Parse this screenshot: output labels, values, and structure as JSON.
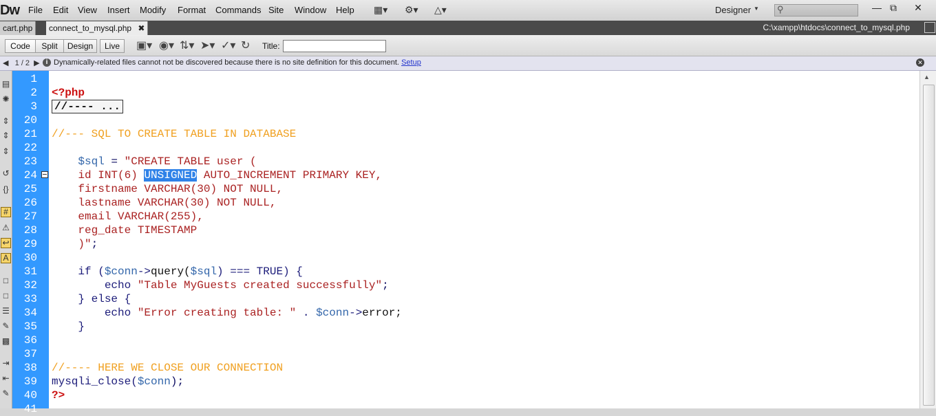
{
  "app": {
    "logo": "Dw"
  },
  "menu": [
    "File",
    "Edit",
    "View",
    "Insert",
    "Modify",
    "Format",
    "Commands",
    "Site",
    "Window",
    "Help"
  ],
  "toolbar_icons": [
    "layout-icon",
    "gear-icon",
    "site-icon"
  ],
  "workspace": {
    "label": "Designer"
  },
  "window_controls": [
    "minimize",
    "maximize",
    "close"
  ],
  "tabs": [
    {
      "label": "cart.php",
      "active": false
    },
    {
      "label": "connect_to_mysql.php",
      "active": true
    }
  ],
  "file_path": "C:\\xampp\\htdocs\\connect_to_mysql.php",
  "doc_toolbar": {
    "views": [
      "Code",
      "Split",
      "Design",
      "Live"
    ],
    "active_view": "Code",
    "title_label": "Title:",
    "title_value": ""
  },
  "info_bar": {
    "nav": "1 / 2",
    "message": "Dynamically-related files cannot not be discovered because there is no site definition for this document.",
    "link": "Setup"
  },
  "code": {
    "line_numbers": [
      "1",
      "2",
      "3",
      "20",
      "21",
      "22",
      "23",
      "24",
      "25",
      "26",
      "27",
      "28",
      "29",
      "30",
      "31",
      "32",
      "33",
      "34",
      "35",
      "36",
      "37",
      "38",
      "39",
      "40",
      "41"
    ],
    "lines": [
      {
        "n": "1",
        "tokens": []
      },
      {
        "n": "2",
        "tokens": [
          {
            "t": "<?php",
            "c": "kw"
          }
        ]
      },
      {
        "n": "3",
        "tokens": [
          {
            "t": "//---- ...",
            "c": "fold"
          }
        ]
      },
      {
        "n": "20",
        "tokens": []
      },
      {
        "n": "21",
        "tokens": [
          {
            "t": "//--- SQL TO CREATE TABLE IN DATABASE",
            "c": "cm"
          }
        ]
      },
      {
        "n": "22",
        "tokens": []
      },
      {
        "n": "23",
        "tokens": [
          {
            "t": "    ",
            "c": "bk"
          },
          {
            "t": "$sql",
            "c": "vb"
          },
          {
            "t": " = ",
            "c": "dk"
          },
          {
            "t": "\"CREATE TABLE user (",
            "c": "r"
          }
        ]
      },
      {
        "n": "24",
        "tokens": [
          {
            "t": "    id INT(6) ",
            "c": "r"
          },
          {
            "t": "UNSIGNED",
            "c": "sel"
          },
          {
            "t": " AUTO_INCREMENT PRIMARY KEY,",
            "c": "r"
          }
        ]
      },
      {
        "n": "25",
        "tokens": [
          {
            "t": "    firstname VARCHAR(30) NOT NULL,",
            "c": "r"
          }
        ]
      },
      {
        "n": "26",
        "tokens": [
          {
            "t": "    lastname VARCHAR(30) NOT NULL,",
            "c": "r"
          }
        ]
      },
      {
        "n": "27",
        "tokens": [
          {
            "t": "    email VARCHAR(255),",
            "c": "r"
          }
        ]
      },
      {
        "n": "28",
        "tokens": [
          {
            "t": "    reg_date TIMESTAMP",
            "c": "r"
          }
        ]
      },
      {
        "n": "29",
        "tokens": [
          {
            "t": "    )\"",
            "c": "r"
          },
          {
            "t": ";",
            "c": "dk"
          }
        ]
      },
      {
        "n": "30",
        "tokens": []
      },
      {
        "n": "31",
        "tokens": [
          {
            "t": "    if (",
            "c": "fn"
          },
          {
            "t": "$conn",
            "c": "vb"
          },
          {
            "t": "->",
            "c": "fn"
          },
          {
            "t": "query(",
            "c": "bk"
          },
          {
            "t": "$sql",
            "c": "vb"
          },
          {
            "t": ") === TRUE) {",
            "c": "fn"
          }
        ]
      },
      {
        "n": "32",
        "tokens": [
          {
            "t": "        echo ",
            "c": "fn"
          },
          {
            "t": "\"Table MyGuests created successfully\"",
            "c": "r"
          },
          {
            "t": ";",
            "c": "dk"
          }
        ]
      },
      {
        "n": "33",
        "tokens": [
          {
            "t": "    } else {",
            "c": "fn"
          }
        ]
      },
      {
        "n": "34",
        "tokens": [
          {
            "t": "        echo ",
            "c": "fn"
          },
          {
            "t": "\"Error creating table: \"",
            "c": "r"
          },
          {
            "t": " . ",
            "c": "fn"
          },
          {
            "t": "$conn",
            "c": "vb"
          },
          {
            "t": "->",
            "c": "fn"
          },
          {
            "t": "error;",
            "c": "bk"
          }
        ]
      },
      {
        "n": "35",
        "tokens": [
          {
            "t": "    }",
            "c": "fn"
          }
        ]
      },
      {
        "n": "36",
        "tokens": []
      },
      {
        "n": "37",
        "tokens": []
      },
      {
        "n": "38",
        "tokens": [
          {
            "t": "//---- HERE WE CLOSE OUR CONNECTION",
            "c": "cm"
          }
        ]
      },
      {
        "n": "39",
        "tokens": [
          {
            "t": "mysqli_close(",
            "c": "fn"
          },
          {
            "t": "$conn",
            "c": "vb"
          },
          {
            "t": ");",
            "c": "dk"
          }
        ]
      },
      {
        "n": "40",
        "tokens": [
          {
            "t": "?>",
            "c": "kw"
          }
        ]
      },
      {
        "n": "41",
        "tokens": []
      }
    ]
  }
}
